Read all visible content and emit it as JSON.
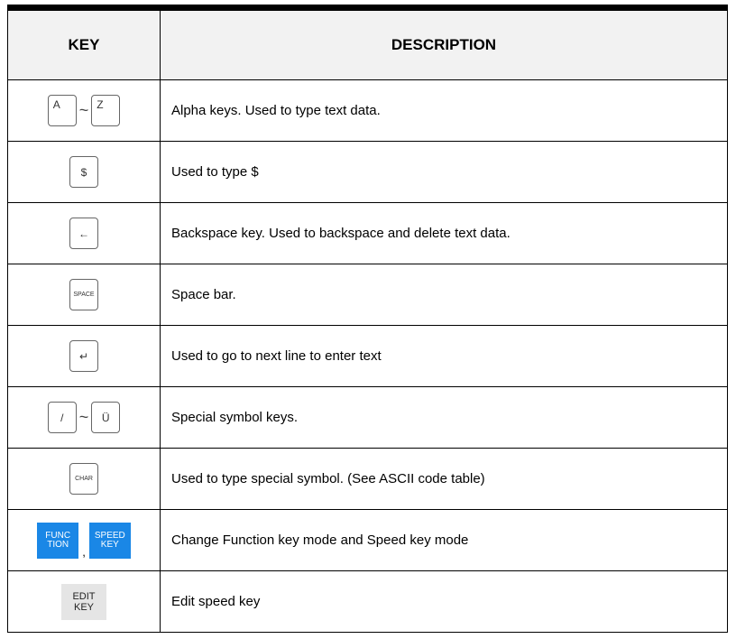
{
  "header": {
    "key": "KEY",
    "description": "DESCRIPTION"
  },
  "rows": [
    {
      "keys": [
        "A",
        "~",
        "Z"
      ],
      "description": "Alpha keys. Used to type text data."
    },
    {
      "keys": [
        "$"
      ],
      "description": "Used to type $"
    },
    {
      "keys": [
        "←"
      ],
      "description": "Backspace key. Used to backspace and delete text data."
    },
    {
      "keys": [
        "SPACE"
      ],
      "description": "Space bar."
    },
    {
      "keys": [
        "↵"
      ],
      "description": "Used to go to next line to enter text"
    },
    {
      "keys": [
        "/",
        "~",
        "Ü"
      ],
      "description": "Special symbol keys."
    },
    {
      "keys": [
        "CHAR"
      ],
      "description": "Used to type special symbol. (See ASCII code table)"
    },
    {
      "keys": [
        "FUNC TION",
        ",",
        "SPEED KEY"
      ],
      "description": "Change Function key mode and Speed key mode"
    },
    {
      "keys": [
        "EDIT KEY"
      ],
      "description": "Edit speed key"
    }
  ],
  "colors": {
    "blue_key": "#1a87e6",
    "gray_key": "#e5e5e5",
    "header_bg": "#f2f2f2"
  }
}
